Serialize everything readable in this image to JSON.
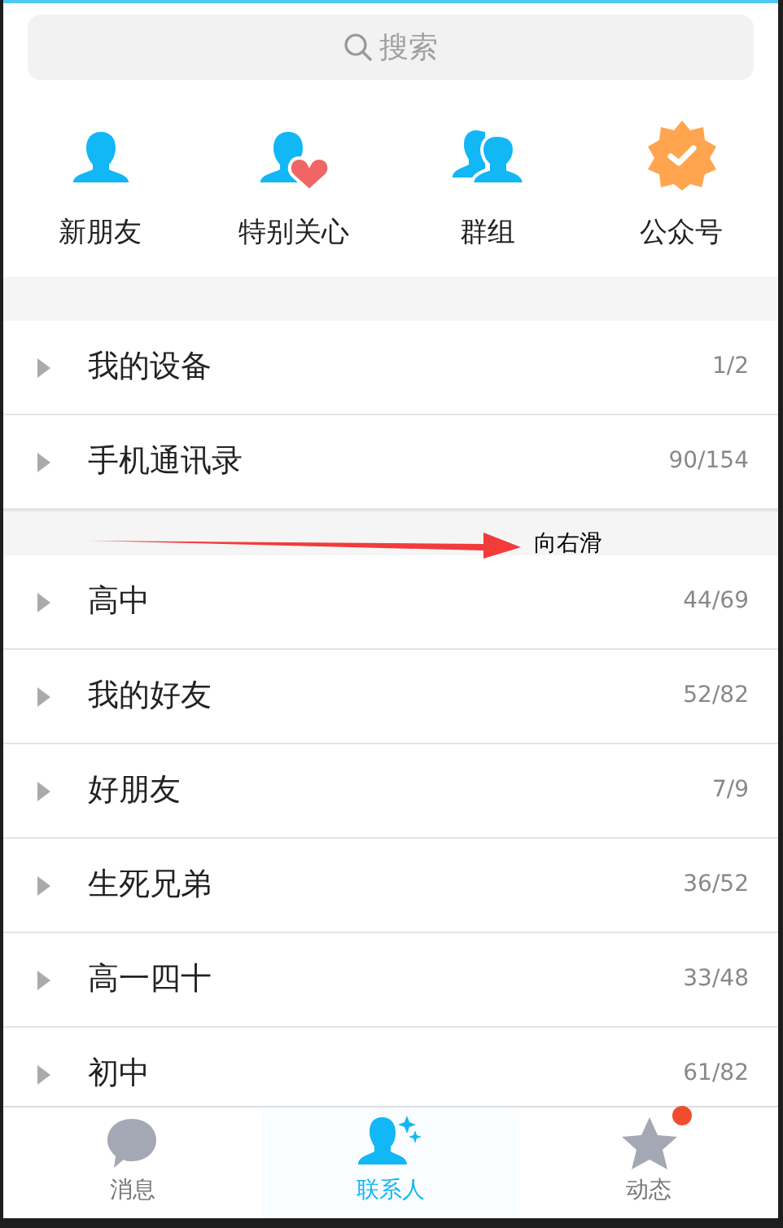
{
  "search": {
    "placeholder": "搜索"
  },
  "shortcuts": [
    {
      "kind": "person",
      "label": "新朋友"
    },
    {
      "kind": "heart",
      "label": "特别关心"
    },
    {
      "kind": "group",
      "label": "群组"
    },
    {
      "kind": "badge",
      "label": "公众号"
    }
  ],
  "pinned_groups": [
    {
      "name": "我的设备",
      "count": "1/2",
      "expanded": false
    },
    {
      "name": "手机通讯录",
      "count": "90/154",
      "expanded": false
    }
  ],
  "annotation": {
    "kind": "arrow",
    "text": "向右滑"
  },
  "groups": [
    {
      "name": "高中",
      "count": "44/69",
      "expanded": false
    },
    {
      "name": "我的好友",
      "count": "52/82",
      "expanded": false
    },
    {
      "name": "好朋友",
      "count": "7/9",
      "expanded": false
    },
    {
      "name": "生死兄弟",
      "count": "36/52",
      "expanded": false
    },
    {
      "name": "高一四十",
      "count": "33/48",
      "expanded": false
    },
    {
      "name": "初中",
      "count": "61/82",
      "expanded": false
    }
  ],
  "tab_bar": [
    {
      "kind": "chat",
      "label": "消息",
      "selected": false,
      "badge": false
    },
    {
      "kind": "contacts",
      "label": "联系人",
      "selected": true,
      "badge": false
    },
    {
      "kind": "star",
      "label": "动态",
      "selected": false,
      "badge": true
    }
  ]
}
